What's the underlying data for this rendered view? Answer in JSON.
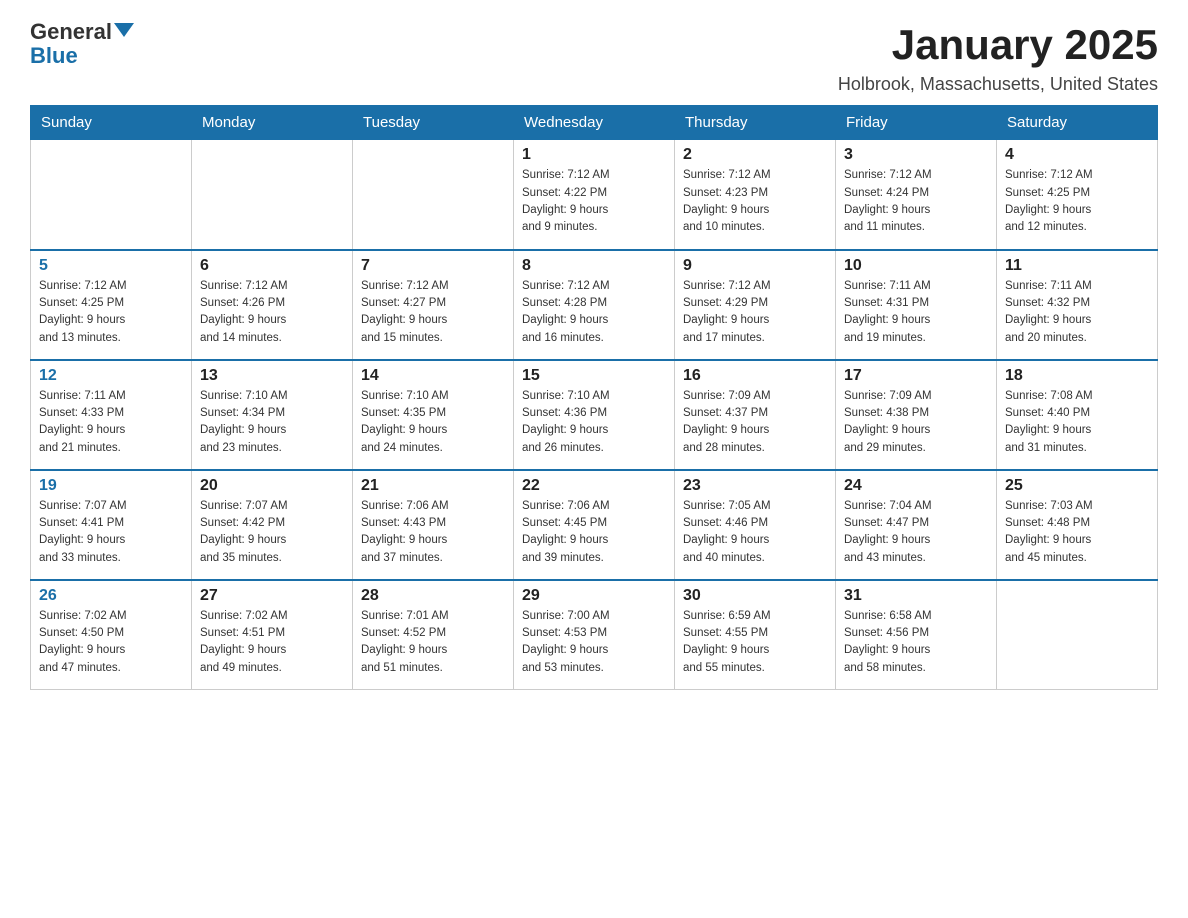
{
  "header": {
    "logo_general": "General",
    "logo_blue": "Blue",
    "month_title": "January 2025",
    "location": "Holbrook, Massachusetts, United States"
  },
  "weekdays": [
    "Sunday",
    "Monday",
    "Tuesday",
    "Wednesday",
    "Thursday",
    "Friday",
    "Saturday"
  ],
  "weeks": [
    [
      {
        "day": "",
        "info": ""
      },
      {
        "day": "",
        "info": ""
      },
      {
        "day": "",
        "info": ""
      },
      {
        "day": "1",
        "info": "Sunrise: 7:12 AM\nSunset: 4:22 PM\nDaylight: 9 hours\nand 9 minutes."
      },
      {
        "day": "2",
        "info": "Sunrise: 7:12 AM\nSunset: 4:23 PM\nDaylight: 9 hours\nand 10 minutes."
      },
      {
        "day": "3",
        "info": "Sunrise: 7:12 AM\nSunset: 4:24 PM\nDaylight: 9 hours\nand 11 minutes."
      },
      {
        "day": "4",
        "info": "Sunrise: 7:12 AM\nSunset: 4:25 PM\nDaylight: 9 hours\nand 12 minutes."
      }
    ],
    [
      {
        "day": "5",
        "info": "Sunrise: 7:12 AM\nSunset: 4:25 PM\nDaylight: 9 hours\nand 13 minutes."
      },
      {
        "day": "6",
        "info": "Sunrise: 7:12 AM\nSunset: 4:26 PM\nDaylight: 9 hours\nand 14 minutes."
      },
      {
        "day": "7",
        "info": "Sunrise: 7:12 AM\nSunset: 4:27 PM\nDaylight: 9 hours\nand 15 minutes."
      },
      {
        "day": "8",
        "info": "Sunrise: 7:12 AM\nSunset: 4:28 PM\nDaylight: 9 hours\nand 16 minutes."
      },
      {
        "day": "9",
        "info": "Sunrise: 7:12 AM\nSunset: 4:29 PM\nDaylight: 9 hours\nand 17 minutes."
      },
      {
        "day": "10",
        "info": "Sunrise: 7:11 AM\nSunset: 4:31 PM\nDaylight: 9 hours\nand 19 minutes."
      },
      {
        "day": "11",
        "info": "Sunrise: 7:11 AM\nSunset: 4:32 PM\nDaylight: 9 hours\nand 20 minutes."
      }
    ],
    [
      {
        "day": "12",
        "info": "Sunrise: 7:11 AM\nSunset: 4:33 PM\nDaylight: 9 hours\nand 21 minutes."
      },
      {
        "day": "13",
        "info": "Sunrise: 7:10 AM\nSunset: 4:34 PM\nDaylight: 9 hours\nand 23 minutes."
      },
      {
        "day": "14",
        "info": "Sunrise: 7:10 AM\nSunset: 4:35 PM\nDaylight: 9 hours\nand 24 minutes."
      },
      {
        "day": "15",
        "info": "Sunrise: 7:10 AM\nSunset: 4:36 PM\nDaylight: 9 hours\nand 26 minutes."
      },
      {
        "day": "16",
        "info": "Sunrise: 7:09 AM\nSunset: 4:37 PM\nDaylight: 9 hours\nand 28 minutes."
      },
      {
        "day": "17",
        "info": "Sunrise: 7:09 AM\nSunset: 4:38 PM\nDaylight: 9 hours\nand 29 minutes."
      },
      {
        "day": "18",
        "info": "Sunrise: 7:08 AM\nSunset: 4:40 PM\nDaylight: 9 hours\nand 31 minutes."
      }
    ],
    [
      {
        "day": "19",
        "info": "Sunrise: 7:07 AM\nSunset: 4:41 PM\nDaylight: 9 hours\nand 33 minutes."
      },
      {
        "day": "20",
        "info": "Sunrise: 7:07 AM\nSunset: 4:42 PM\nDaylight: 9 hours\nand 35 minutes."
      },
      {
        "day": "21",
        "info": "Sunrise: 7:06 AM\nSunset: 4:43 PM\nDaylight: 9 hours\nand 37 minutes."
      },
      {
        "day": "22",
        "info": "Sunrise: 7:06 AM\nSunset: 4:45 PM\nDaylight: 9 hours\nand 39 minutes."
      },
      {
        "day": "23",
        "info": "Sunrise: 7:05 AM\nSunset: 4:46 PM\nDaylight: 9 hours\nand 40 minutes."
      },
      {
        "day": "24",
        "info": "Sunrise: 7:04 AM\nSunset: 4:47 PM\nDaylight: 9 hours\nand 43 minutes."
      },
      {
        "day": "25",
        "info": "Sunrise: 7:03 AM\nSunset: 4:48 PM\nDaylight: 9 hours\nand 45 minutes."
      }
    ],
    [
      {
        "day": "26",
        "info": "Sunrise: 7:02 AM\nSunset: 4:50 PM\nDaylight: 9 hours\nand 47 minutes."
      },
      {
        "day": "27",
        "info": "Sunrise: 7:02 AM\nSunset: 4:51 PM\nDaylight: 9 hours\nand 49 minutes."
      },
      {
        "day": "28",
        "info": "Sunrise: 7:01 AM\nSunset: 4:52 PM\nDaylight: 9 hours\nand 51 minutes."
      },
      {
        "day": "29",
        "info": "Sunrise: 7:00 AM\nSunset: 4:53 PM\nDaylight: 9 hours\nand 53 minutes."
      },
      {
        "day": "30",
        "info": "Sunrise: 6:59 AM\nSunset: 4:55 PM\nDaylight: 9 hours\nand 55 minutes."
      },
      {
        "day": "31",
        "info": "Sunrise: 6:58 AM\nSunset: 4:56 PM\nDaylight: 9 hours\nand 58 minutes."
      },
      {
        "day": "",
        "info": ""
      }
    ]
  ]
}
